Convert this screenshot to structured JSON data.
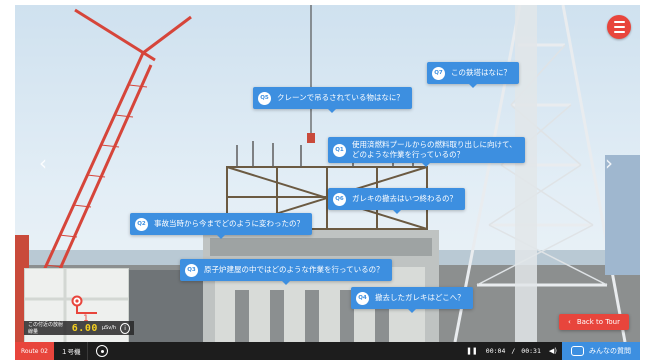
{
  "questions": [
    {
      "num": "Q7",
      "text": "この鉄塔はなに？"
    },
    {
      "num": "Q5",
      "text": "クレーンで吊るされている物はなに？"
    },
    {
      "num": "Q1",
      "text": "使用済燃料プールからの燃料取り出しに向けて、\nどのような作業を行っているの？"
    },
    {
      "num": "Q6",
      "text": "ガレキの撤去はいつ終わるの？"
    },
    {
      "num": "Q2",
      "text": "事故当時から今までどのように変わったの？"
    },
    {
      "num": "Q3",
      "text": "原子炉建屋の中ではどのような作業を行っているの？"
    },
    {
      "num": "Q4",
      "text": "撤去したガレキはどこへ？"
    }
  ],
  "radiation": {
    "label": "この付近の放射線量",
    "value": "6.00",
    "unit": "μSv/h",
    "info": "i"
  },
  "map": {
    "marker_num": "1"
  },
  "back_button": {
    "arrow": "‹",
    "label": "Back to Tour"
  },
  "nav": {
    "left": "‹",
    "right": "›"
  },
  "bottom_bar": {
    "route": "Route 02",
    "unit": "１号機",
    "pause": "❚❚",
    "time_current": "00:04",
    "time_sep": "/",
    "time_total": "00:31",
    "volume": "◀)",
    "qa_label": "みんなの質問"
  },
  "colors": {
    "accent_red": "#e8453c",
    "bubble_blue": "#3d8fe0",
    "bar": "#1d1d1d",
    "rad_value": "#f5d020"
  }
}
